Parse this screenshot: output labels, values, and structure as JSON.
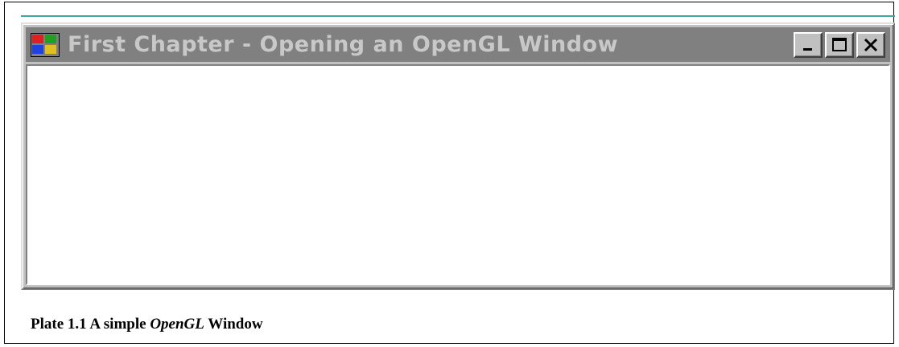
{
  "window": {
    "title": "First Chapter - Opening an OpenGL Window",
    "app_icon": "windows-flag-icon",
    "controls": {
      "minimize_icon": "minimize-icon",
      "maximize_icon": "maximize-icon",
      "close_icon": "close-icon"
    }
  },
  "caption": {
    "prefix": "Plate 1.1 A simple",
    "emphasis": "OpenGL",
    "suffix": "Window"
  },
  "colors": {
    "titlebar_inactive": "#808080",
    "title_text": "#c8c8c8",
    "window_face": "#c0c0c0",
    "accent": "#3aa9a3"
  }
}
